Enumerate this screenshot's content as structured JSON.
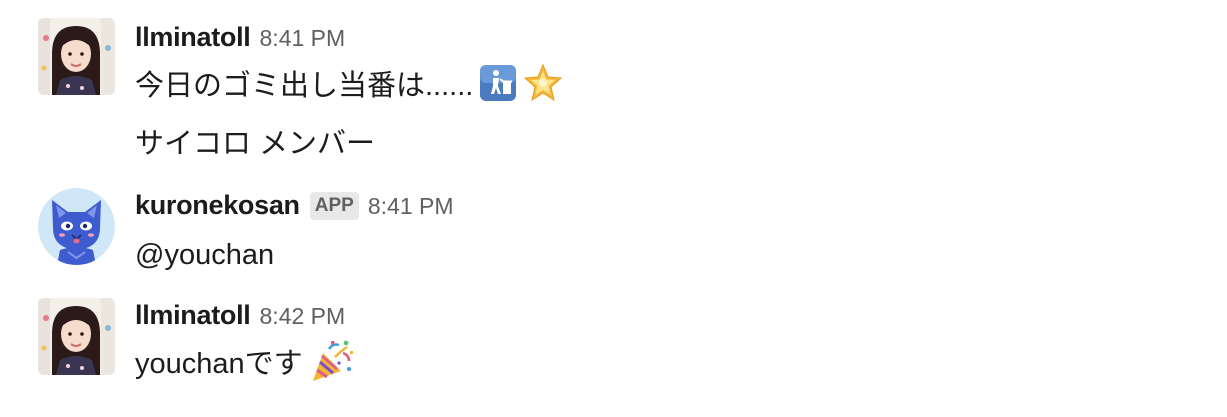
{
  "messages": [
    {
      "author": "llminatoll",
      "time": "8:41 PM",
      "avatar": "girl-photo-avatar",
      "lines": [
        "今日のゴミ出し当番は......",
        "サイコロ メンバー"
      ],
      "emojis": [
        "wastebasket-icon",
        "star-glow-icon"
      ]
    },
    {
      "author": "kuronekosan",
      "badge": "APP",
      "time": "8:41 PM",
      "avatar": "blue-cat-avatar",
      "lines": [
        "@youchan"
      ]
    },
    {
      "author": "llminatoll",
      "time": "8:42 PM",
      "avatar": "girl-photo-avatar",
      "lines": [
        "youchanです"
      ],
      "emojis": [
        "party-popper-icon"
      ]
    }
  ],
  "colors": {
    "text": "#1d1c1d",
    "timestamp": "#616061",
    "badge_bg": "#e8e8e8",
    "cat_body": "#3f5bd0",
    "cat_bg": "#cfe7f7",
    "trash_bg": "#4a7ac0"
  }
}
